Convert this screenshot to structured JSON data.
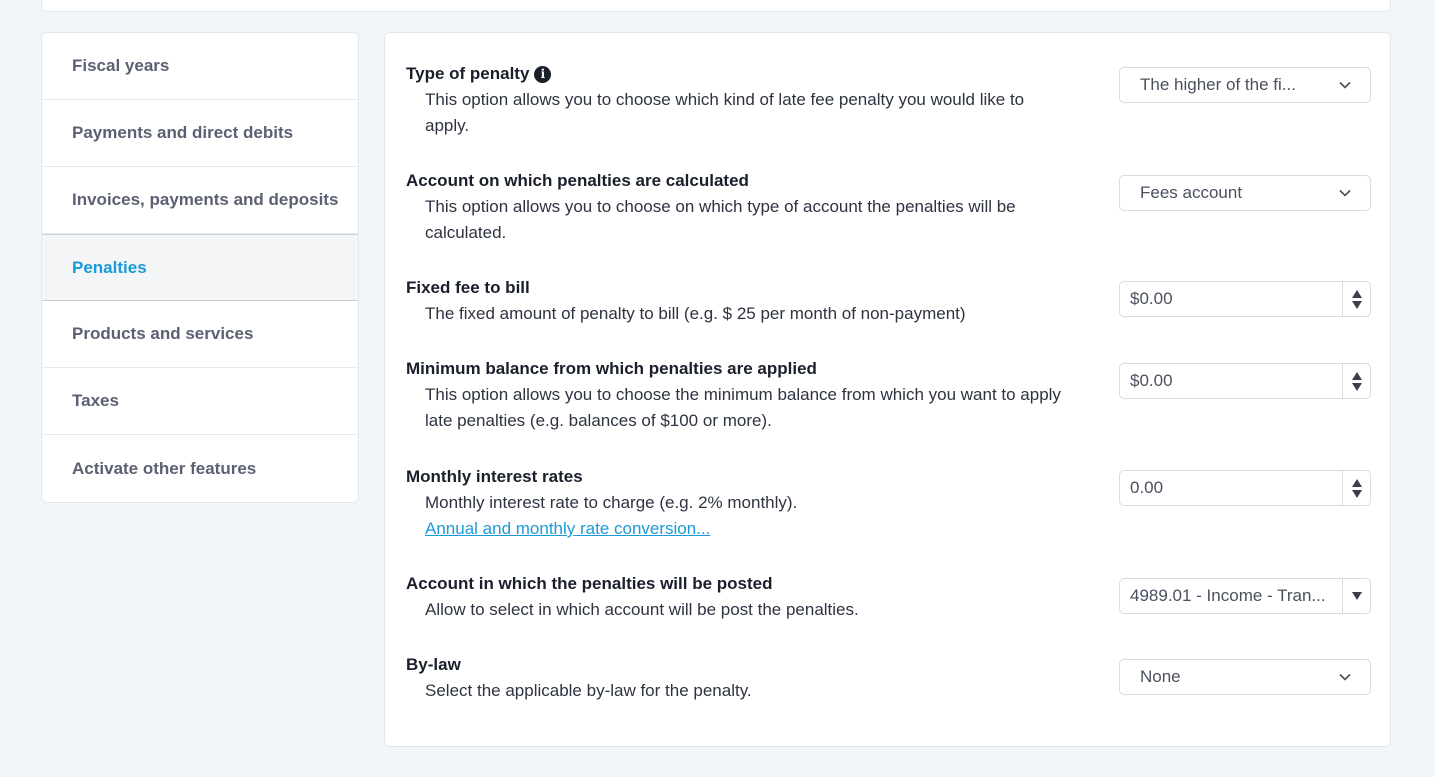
{
  "sidebar": {
    "items": [
      {
        "label": "Fiscal years"
      },
      {
        "label": "Payments and direct debits"
      },
      {
        "label": "Invoices, payments and deposits"
      },
      {
        "label": "Penalties"
      },
      {
        "label": "Products and services"
      },
      {
        "label": "Taxes"
      },
      {
        "label": "Activate other features"
      }
    ],
    "active": "Penalties"
  },
  "settings": {
    "type_of_penalty": {
      "title": "Type of penalty",
      "description": "This option allows you to choose which kind of late fee penalty you would like to apply.",
      "value": "The higher of the fi..."
    },
    "penalty_account": {
      "title": "Account on which penalties are calculated",
      "description": "This option allows you to choose on which type of account the penalties will be calculated.",
      "value": "Fees account"
    },
    "fixed_fee": {
      "title": "Fixed fee to bill",
      "description": "The fixed amount of penalty to bill (e.g. $ 25 per month of non-payment)",
      "value": "$0.00"
    },
    "minimum_balance": {
      "title": "Minimum balance from which penalties are applied",
      "description": "This option allows you to choose the minimum balance from which you want to apply late penalties (e.g. balances of $100 or more).",
      "value": "$0.00"
    },
    "monthly_interest": {
      "title": "Monthly interest rates",
      "description": "Monthly interest rate to charge (e.g. 2% monthly).",
      "link": "Annual and monthly rate conversion...",
      "value": "0.00"
    },
    "posting_account": {
      "title": "Account in which the penalties will be posted",
      "description": "Allow to select in which account will be post the penalties.",
      "value": "4989.01 - Income - Tran..."
    },
    "bylaw": {
      "title": "By-law",
      "description": "Select the applicable by-law for the penalty.",
      "value": "None"
    }
  },
  "icons": {
    "info": "info-circle-icon",
    "select_arrow": "chevron-down-icon",
    "spinner": "spinner-arrows-icon",
    "combo_arrow": "caret-down-icon"
  },
  "colors": {
    "accent": "#1a9ad8",
    "background": "#f3f6f9",
    "card": "#ffffff"
  }
}
